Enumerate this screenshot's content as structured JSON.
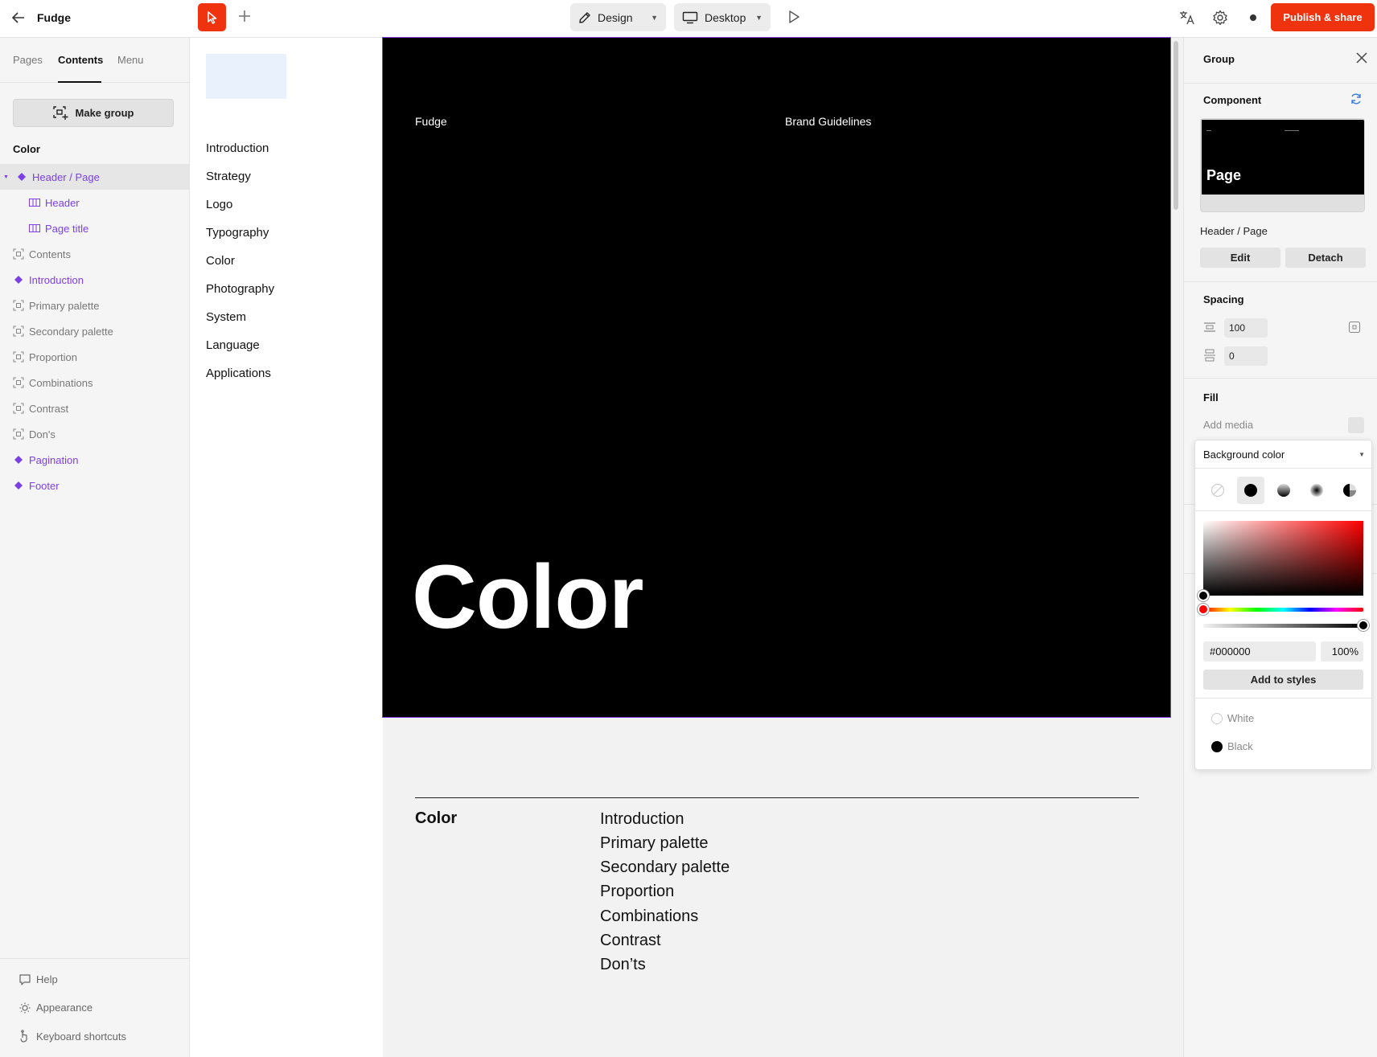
{
  "topbar": {
    "project_name": "Fudge",
    "mode_label": "Design",
    "device_label": "Desktop",
    "publish_label": "Publish & share"
  },
  "left_panel": {
    "tabs": [
      "Pages",
      "Contents",
      "Menu"
    ],
    "active_tab": "Contents",
    "make_group_label": "Make group",
    "section_label": "Color",
    "layers": [
      {
        "label": "Header / Page",
        "kind": "component",
        "selected": true
      },
      {
        "label": "Header",
        "kind": "instance"
      },
      {
        "label": "Page title",
        "kind": "instance"
      },
      {
        "label": "Contents",
        "kind": "group"
      },
      {
        "label": "Introduction",
        "kind": "component"
      },
      {
        "label": "Primary palette",
        "kind": "group"
      },
      {
        "label": "Secondary palette",
        "kind": "group"
      },
      {
        "label": "Proportion",
        "kind": "group"
      },
      {
        "label": "Combinations",
        "kind": "group"
      },
      {
        "label": "Contrast",
        "kind": "group"
      },
      {
        "label": "Don's",
        "kind": "group"
      },
      {
        "label": "Pagination",
        "kind": "component"
      },
      {
        "label": "Footer",
        "kind": "component"
      }
    ],
    "footer": {
      "help": "Help",
      "appearance": "Appearance",
      "shortcuts": "Keyboard shortcuts"
    }
  },
  "contents_panel": {
    "items": [
      "Introduction",
      "Strategy",
      "Logo",
      "Typography",
      "Color",
      "Photography",
      "System",
      "Language",
      "Applications"
    ]
  },
  "canvas": {
    "brand": "Fudge",
    "guidelines": "Brand Guidelines",
    "page_title": "Color",
    "toc_label": "Color",
    "toc_items": [
      "Introduction",
      "Primary palette",
      "Secondary palette",
      "Proportion",
      "Combinations",
      "Contrast",
      "Don’ts"
    ]
  },
  "right_panel": {
    "title": "Group",
    "component_label": "Component",
    "preview_title": "Page",
    "component_name": "Header / Page",
    "edit_label": "Edit",
    "detach_label": "Detach",
    "spacing_label": "Spacing",
    "spacing_value_1": "100",
    "spacing_value_2": "0",
    "fill_label": "Fill",
    "add_media_label": "Add media"
  },
  "color_picker": {
    "dropdown_label": "Background color",
    "hex": "#000000",
    "opacity": "100%",
    "add_to_styles": "Add to styles",
    "styles": [
      {
        "name": "White",
        "color": "#ffffff"
      },
      {
        "name": "Black",
        "color": "#000000"
      }
    ]
  },
  "colors": {
    "accent": "#f0330f",
    "selection": "#7b3fe4"
  }
}
